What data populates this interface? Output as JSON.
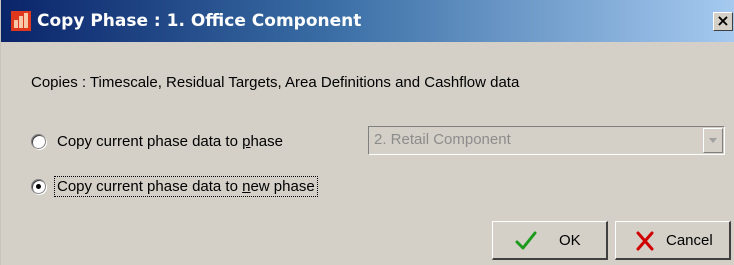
{
  "window": {
    "title": "Copy Phase : 1. Office Component",
    "close_glyph": "×",
    "icon": "app-icon"
  },
  "content": {
    "copies_text": "Copies : Timescale, Residual Targets, Area Definitions and Cashflow data"
  },
  "options": [
    {
      "label": "Copy current phase data to phase",
      "selected": false
    },
    {
      "label": "Copy current phase data to new phase",
      "selected": true
    }
  ],
  "phase_select": {
    "value": "2. Retail Component",
    "disabled": true
  },
  "buttons": {
    "ok_label": "OK",
    "cancel_label": "Cancel"
  },
  "colors": {
    "title_bar_start": "#0a246a",
    "title_bar_end": "#a6caf0",
    "dialog_bg": "#d4d0c8",
    "ok_check": "#1c9a1c",
    "cancel_x": "#d00000"
  }
}
